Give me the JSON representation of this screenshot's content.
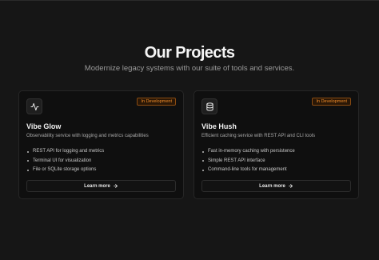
{
  "header": {
    "title": "Our Projects",
    "subtitle": "Modernize legacy systems with our suite of tools and services."
  },
  "projects": [
    {
      "name": "Vibe Glow",
      "icon": "activity-pulse-icon",
      "status": "In Development",
      "description": "Observability service with logging and metrics capabilities",
      "features": [
        "REST API for logging and metrics",
        "Terminal UI for visualization",
        "File or SQLite storage options"
      ],
      "cta": "Learn more"
    },
    {
      "name": "Vibe Hush",
      "icon": "database-icon",
      "status": "In Development",
      "description": "Efficient caching service with REST API and CLI tools",
      "features": [
        "Fast in-memory caching with persistence",
        "Simple REST API interface",
        "Command-line tools for management"
      ],
      "cta": "Learn more"
    }
  ],
  "colors": {
    "background": "#161616",
    "card": "#0f0f0f",
    "badge_text": "#f08c2a",
    "badge_border": "#8a4b12"
  }
}
